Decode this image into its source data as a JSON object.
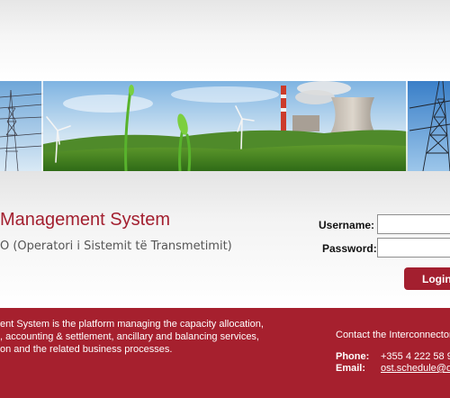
{
  "header": {
    "title": "Management System",
    "subtitle": "O (Operatori i Sistemit të Transmetimit)"
  },
  "login": {
    "username_label": "Username:",
    "username_value": "",
    "password_label": "Password:",
    "password_value": "",
    "login_button": "Login"
  },
  "footer": {
    "description_lines": [
      "ent System is the platform managing the capacity allocation,",
      ", accounting & settlement, ancillary and balancing services,",
      "on and the related business processes."
    ],
    "contact_heading": "Contact the Interconnector",
    "phone_label": "Phone:",
    "phone_value": "+355 4 222 58 9",
    "email_label": "Email:",
    "email_value": "ost.schedule@o"
  },
  "colors": {
    "brand_red": "#a31f2f",
    "footer_red": "#a6202e"
  }
}
